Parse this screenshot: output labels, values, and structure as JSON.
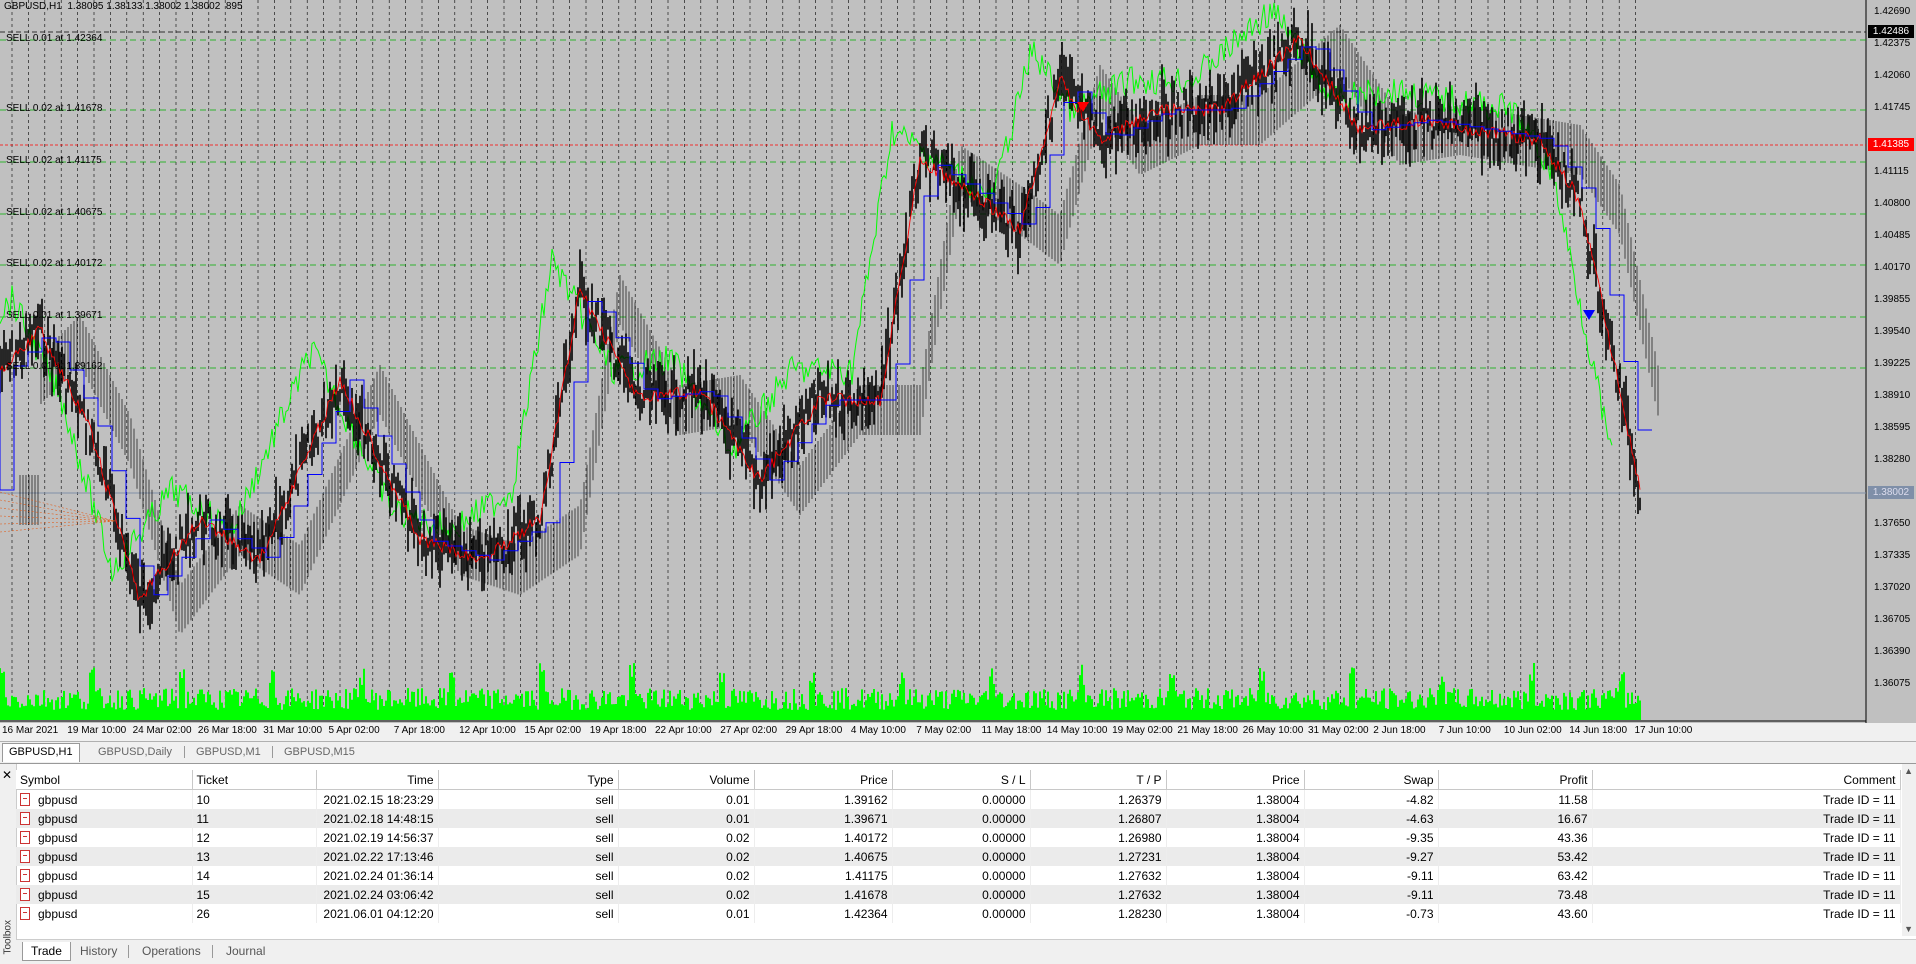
{
  "chart": {
    "header": "GBPUSD,H1  1.38095 1.38133 1.38002 1.38002  895",
    "colors": {
      "background": "#c0c0c0",
      "bid_line": "#ff0000",
      "current_line": "#7f8fa8",
      "volume": "#00ff00",
      "chikou": "#00ff00",
      "kijun": "#0000ff",
      "tenkan": "#ff0000",
      "candles": "#000000",
      "order_lines": "#00b000"
    },
    "order_labels": [
      "SELL 0.01 at 1.42364",
      "SELL 0.02 at 1.41678",
      "SELL 0.02 at 1.41175",
      "SELL 0.02 at 1.40675",
      "SELL 0.02 at 1.40172",
      "SELL 0.01 at 1.39671",
      "SELL 0.01 at 1.39162"
    ],
    "price_axis": [
      "1.42690",
      "1.42375",
      "1.42060",
      "1.41745",
      "1.41115",
      "1.40800",
      "1.40485",
      "1.40170",
      "1.39855",
      "1.39540",
      "1.39225",
      "1.38910",
      "1.38595",
      "1.38280",
      "1.37650",
      "1.37335",
      "1.37020",
      "1.36705",
      "1.36390",
      "1.36075"
    ],
    "price_boxes": {
      "high": "1.42486",
      "bid": "1.41385",
      "current": "1.38002"
    },
    "time_axis": [
      "16 Mar 2021",
      "19 Mar 10:00",
      "24 Mar 02:00",
      "26 Mar 18:00",
      "31 Mar 10:00",
      "5 Apr 02:00",
      "7 Apr 18:00",
      "12 Apr 10:00",
      "15 Apr 02:00",
      "19 Apr 18:00",
      "22 Apr 10:00",
      "27 Apr 02:00",
      "29 Apr 18:00",
      "4 May 10:00",
      "7 May 02:00",
      "11 May 18:00",
      "14 May 10:00",
      "19 May 02:00",
      "21 May 18:00",
      "26 May 10:00",
      "31 May 02:00",
      "2 Jun 18:00",
      "7 Jun 10:00",
      "10 Jun 02:00",
      "14 Jun 18:00",
      "17 Jun 10:00"
    ]
  },
  "chart_tabs": [
    "GBPUSD,H1",
    "GBPUSD,Daily",
    "GBPUSD,M1",
    "GBPUSD,M15"
  ],
  "toolbox": {
    "side_label": "Toolbox",
    "columns": [
      "Symbol",
      "Ticket",
      "Time",
      "Type",
      "Volume",
      "Price",
      "S / L",
      "T / P",
      "Price",
      "Swap",
      "Profit",
      "Comment"
    ],
    "rows": [
      [
        "gbpusd",
        "10",
        "2021.02.15 18:23:29",
        "sell",
        "0.01",
        "1.39162",
        "0.00000",
        "1.26379",
        "1.38004",
        "-4.82",
        "11.58",
        "Trade ID = 11"
      ],
      [
        "gbpusd",
        "11",
        "2021.02.18 14:48:15",
        "sell",
        "0.01",
        "1.39671",
        "0.00000",
        "1.26807",
        "1.38004",
        "-4.63",
        "16.67",
        "Trade ID = 11"
      ],
      [
        "gbpusd",
        "12",
        "2021.02.19 14:56:37",
        "sell",
        "0.02",
        "1.40172",
        "0.00000",
        "1.26980",
        "1.38004",
        "-9.35",
        "43.36",
        "Trade ID = 11"
      ],
      [
        "gbpusd",
        "13",
        "2021.02.22 17:13:46",
        "sell",
        "0.02",
        "1.40675",
        "0.00000",
        "1.27231",
        "1.38004",
        "-9.27",
        "53.42",
        "Trade ID = 11"
      ],
      [
        "gbpusd",
        "14",
        "2021.02.24 01:36:14",
        "sell",
        "0.02",
        "1.41175",
        "0.00000",
        "1.27632",
        "1.38004",
        "-9.11",
        "63.42",
        "Trade ID = 11"
      ],
      [
        "gbpusd",
        "15",
        "2021.02.24 03:06:42",
        "sell",
        "0.02",
        "1.41678",
        "0.00000",
        "1.27632",
        "1.38004",
        "-9.11",
        "73.48",
        "Trade ID = 11"
      ],
      [
        "gbpusd",
        "26",
        "2021.06.01 04:12:20",
        "sell",
        "0.01",
        "1.42364",
        "0.00000",
        "1.28230",
        "1.38004",
        "-0.73",
        "43.60",
        "Trade ID = 11"
      ]
    ],
    "bottom_tabs": [
      "Trade",
      "History",
      "Operations",
      "Journal"
    ]
  }
}
